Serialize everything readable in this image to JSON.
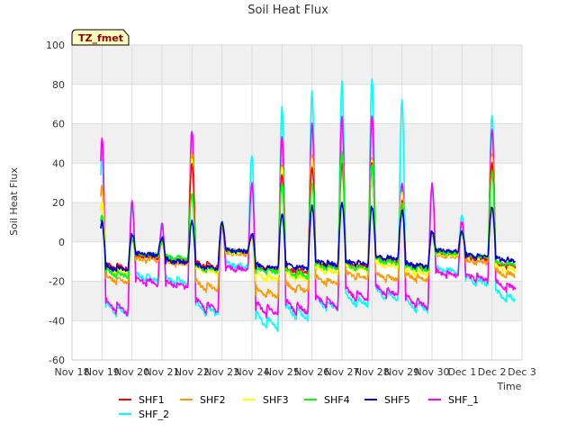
{
  "chart_data": {
    "type": "line",
    "title": "Soil Heat Flux",
    "xlabel": "Time",
    "ylabel": "Soil Heat Flux",
    "site_tag": "TZ_fmet",
    "ylim": [
      -60,
      100
    ],
    "yticks": [
      "-60",
      "-40",
      "-20",
      "0",
      "20",
      "40",
      "60",
      "80",
      "100"
    ],
    "xlim": [
      "Nov 18",
      "Dec 3"
    ],
    "xticks": [
      "Nov 18",
      "Nov 19",
      "Nov 20",
      "Nov 21",
      "Nov 22",
      "Nov 23",
      "Nov 24",
      "Nov 25",
      "Nov 26",
      "Nov 27",
      "Nov 28",
      "Nov 29",
      "Nov 30",
      "Dec 1",
      "Dec 2",
      "Dec 3"
    ],
    "grid": true,
    "legend_position": "bottom",
    "day_labels": [
      "Nov 19",
      "Nov 20",
      "Nov 21",
      "Nov 22",
      "Nov 23",
      "Nov 24",
      "Nov 25",
      "Nov 26",
      "Nov 27",
      "Nov 28",
      "Nov 29",
      "Nov 30",
      "Dec 1",
      "Dec 2"
    ],
    "series_note": "one value per day = approximate daily peak (midday) and daily minimum (night)",
    "series": [
      {
        "name": "SHF1",
        "color": "#ff0000",
        "peaks": [
          10,
          2,
          0,
          40,
          9,
          3,
          35,
          38,
          40,
          40,
          20,
          4,
          5,
          40
        ],
        "mins": [
          -14,
          -8,
          -10,
          -13,
          -5,
          -15,
          -16,
          -13,
          -13,
          -10,
          -14,
          -6,
          -9,
          -13
        ]
      },
      {
        "name": "SHF2",
        "color": "#ff9900",
        "peaks": [
          28,
          2,
          0,
          45,
          9,
          3,
          40,
          45,
          45,
          42,
          22,
          4,
          5,
          45
        ],
        "mins": [
          -21,
          -10,
          -12,
          -25,
          -7,
          -29,
          -26,
          -22,
          -19,
          -20,
          -20,
          -8,
          -11,
          -18
        ]
      },
      {
        "name": "SHF3",
        "color": "#ffff00",
        "peaks": [
          20,
          3,
          0,
          42,
          9,
          3,
          38,
          42,
          45,
          42,
          25,
          4,
          5,
          42
        ],
        "mins": [
          -16,
          -8,
          -11,
          -16,
          -6,
          -20,
          -20,
          -16,
          -15,
          -13,
          -17,
          -7,
          -9,
          -15
        ]
      },
      {
        "name": "SHF4",
        "color": "#00ff00",
        "peaks": [
          14,
          2,
          0,
          25,
          9,
          3,
          30,
          30,
          45,
          40,
          20,
          4,
          5,
          35
        ],
        "mins": [
          -18,
          -7,
          -9,
          -15,
          -5,
          -16,
          -18,
          -14,
          -14,
          -11,
          -15,
          -6,
          -8,
          -12
        ]
      },
      {
        "name": "SHF5",
        "color": "#0000cc",
        "peaks": [
          10,
          4,
          2,
          10,
          10,
          4,
          14,
          18,
          20,
          18,
          16,
          5,
          5,
          18
        ],
        "mins": [
          -15,
          -7,
          -11,
          -14,
          -5,
          -14,
          -14,
          -12,
          -12,
          -9,
          -13,
          -5,
          -8,
          -10
        ]
      },
      {
        "name": "SHF_1",
        "color": "#ff00ff",
        "peaks": [
          53,
          20,
          9,
          57,
          9,
          30,
          53,
          60,
          63,
          64,
          30,
          29,
          10,
          57
        ],
        "mins": [
          -37,
          -22,
          -24,
          -36,
          -15,
          -38,
          -37,
          -34,
          -30,
          -28,
          -34,
          -18,
          -20,
          -25
        ]
      },
      {
        "name": "SHF_2",
        "color": "#00ffff",
        "peaks": [
          45,
          17,
          9,
          56,
          10,
          44,
          68,
          76,
          81,
          82,
          72,
          27,
          14,
          65
        ],
        "mins": [
          -38,
          -20,
          -22,
          -38,
          -13,
          -45,
          -40,
          -35,
          -33,
          -30,
          -36,
          -16,
          -22,
          -31
        ]
      }
    ]
  }
}
